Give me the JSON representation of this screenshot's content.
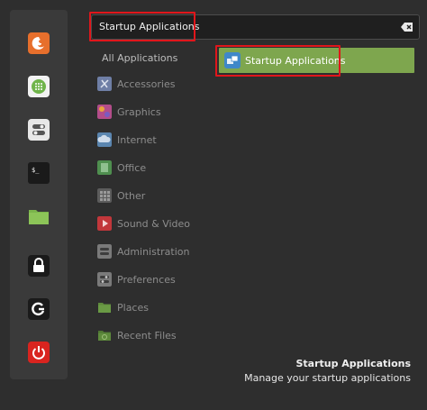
{
  "search": {
    "value": "Startup Applications"
  },
  "favorites": [
    {
      "name": "firefox-icon",
      "color": "#e76f2c"
    },
    {
      "name": "software-manager-icon",
      "color": "#6fb44a"
    },
    {
      "name": "settings-toggle-icon",
      "color": "#e8e8e8"
    },
    {
      "name": "terminal-icon",
      "color": "#1a1a1a"
    },
    {
      "name": "folder-icon",
      "color": "#7bb54b"
    },
    {
      "name": "lock-screen-icon",
      "color": "#1a1a1a"
    },
    {
      "name": "logout-icon",
      "color": "#1a1a1a"
    },
    {
      "name": "power-icon",
      "color": "#d9241f"
    }
  ],
  "categories": {
    "all": "All Applications",
    "items": [
      {
        "label": "Accessories",
        "icon": "accessories-icon",
        "color": "#6f7fa6"
      },
      {
        "label": "Graphics",
        "icon": "graphics-icon",
        "color": "#b34d8a"
      },
      {
        "label": "Internet",
        "icon": "internet-icon",
        "color": "#5b86b0"
      },
      {
        "label": "Office",
        "icon": "office-icon",
        "color": "#4f8f4f"
      },
      {
        "label": "Other",
        "icon": "other-icon",
        "color": "#6a6a6a"
      },
      {
        "label": "Sound & Video",
        "icon": "sound-video-icon",
        "color": "#c2373b"
      },
      {
        "label": "Administration",
        "icon": "administration-icon",
        "color": "#8a8a8a"
      },
      {
        "label": "Preferences",
        "icon": "preferences-icon",
        "color": "#8a8a8a"
      },
      {
        "label": "Places",
        "icon": "places-icon",
        "color": "#6a9a45"
      },
      {
        "label": "Recent Files",
        "icon": "recent-files-icon",
        "color": "#5e8a3c"
      }
    ]
  },
  "result": {
    "label": "Startup Applications",
    "icon": "startup-applications-icon"
  },
  "footer": {
    "title": "Startup Applications",
    "description": "Manage your startup applications"
  },
  "colors": {
    "accent": "#7ea64e",
    "highlight": "#e0161b"
  }
}
